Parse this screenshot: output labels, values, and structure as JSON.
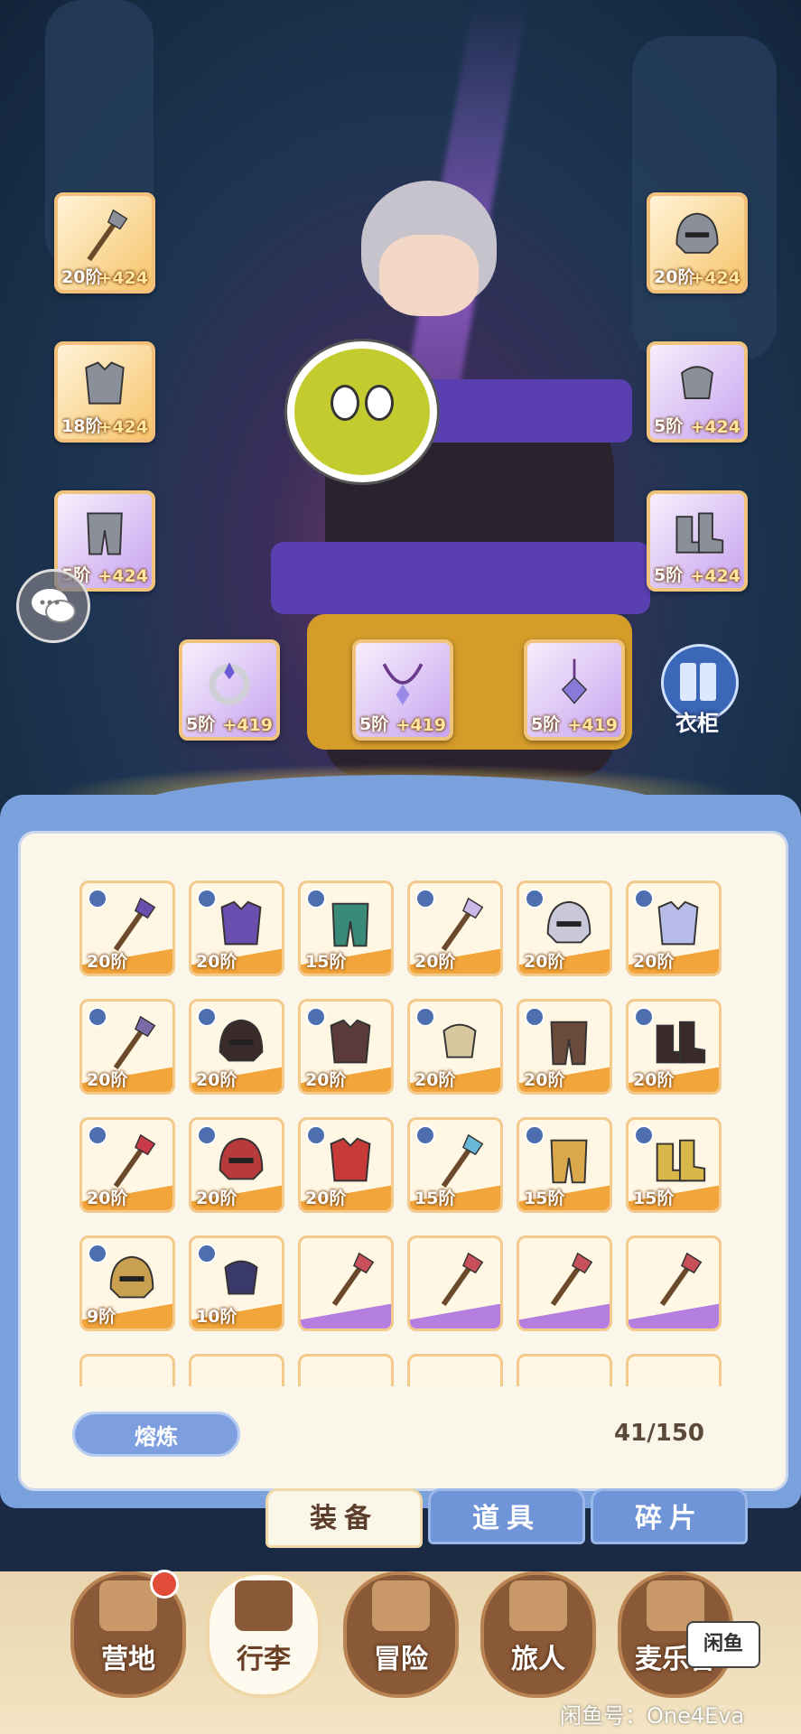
{
  "equipped": [
    {
      "name": "slot-weapon",
      "tier": "20阶",
      "bonus": "+424",
      "color": "#f6c46a",
      "icon": "weapon-staff-icon"
    },
    {
      "name": "slot-helmet",
      "tier": "20阶",
      "bonus": "+424",
      "color": "#f6c46a",
      "icon": "helmet-icon"
    },
    {
      "name": "slot-armor",
      "tier": "18阶",
      "bonus": "+424",
      "color": "#f6c46a",
      "icon": "armor-icon"
    },
    {
      "name": "slot-gloves",
      "tier": "5阶",
      "bonus": "+424",
      "color": "#c7a4ef",
      "icon": "gloves-icon"
    },
    {
      "name": "slot-pants",
      "tier": "5阶",
      "bonus": "+424",
      "color": "#c7a4ef",
      "icon": "pants-icon"
    },
    {
      "name": "slot-boots",
      "tier": "5阶",
      "bonus": "+424",
      "color": "#c7a4ef",
      "icon": "boots-icon"
    },
    {
      "name": "slot-ring",
      "tier": "5阶",
      "bonus": "+419",
      "color": "#c7a4ef",
      "icon": "ring-icon"
    },
    {
      "name": "slot-necklace",
      "tier": "5阶",
      "bonus": "+419",
      "color": "#c7a4ef",
      "icon": "necklace-icon"
    },
    {
      "name": "slot-charm",
      "tier": "5阶",
      "bonus": "+419",
      "color": "#c7a4ef",
      "icon": "charm-icon"
    }
  ],
  "wardrobe": {
    "label": "衣柜"
  },
  "inventory": {
    "items": [
      {
        "tier": "20阶",
        "rarity": "orange",
        "icon": "staff-icon",
        "tint": "#6a4fb0"
      },
      {
        "tier": "20阶",
        "rarity": "orange",
        "icon": "armor-icon",
        "tint": "#6a4fb0"
      },
      {
        "tier": "15阶",
        "rarity": "orange",
        "icon": "pants-icon",
        "tint": "#3a8a7a"
      },
      {
        "tier": "20阶",
        "rarity": "orange",
        "icon": "staff-icon",
        "tint": "#c9b8e8"
      },
      {
        "tier": "20阶",
        "rarity": "orange",
        "icon": "helmet-icon",
        "tint": "#c8c8d8"
      },
      {
        "tier": "20阶",
        "rarity": "orange",
        "icon": "armor-icon",
        "tint": "#b8bce8"
      },
      {
        "tier": "20阶",
        "rarity": "orange",
        "icon": "staff-icon",
        "tint": "#7a6aa8"
      },
      {
        "tier": "20阶",
        "rarity": "orange",
        "icon": "helmet-icon",
        "tint": "#3a2a2a"
      },
      {
        "tier": "20阶",
        "rarity": "orange",
        "icon": "armor-icon",
        "tint": "#5a3a3a"
      },
      {
        "tier": "20阶",
        "rarity": "orange",
        "icon": "gloves-icon",
        "tint": "#d8c8a0"
      },
      {
        "tier": "20阶",
        "rarity": "orange",
        "icon": "pants-icon",
        "tint": "#6a4a3a"
      },
      {
        "tier": "20阶",
        "rarity": "orange",
        "icon": "boots-icon",
        "tint": "#3a2a2a"
      },
      {
        "tier": "20阶",
        "rarity": "orange",
        "icon": "staff-icon",
        "tint": "#c83a4a"
      },
      {
        "tier": "20阶",
        "rarity": "orange",
        "icon": "helmet-icon",
        "tint": "#b83a3a"
      },
      {
        "tier": "20阶",
        "rarity": "orange",
        "icon": "armor-icon",
        "tint": "#c83a3a"
      },
      {
        "tier": "15阶",
        "rarity": "orange",
        "icon": "staff-icon",
        "tint": "#6ab8d8"
      },
      {
        "tier": "15阶",
        "rarity": "orange",
        "icon": "pants-icon",
        "tint": "#d8a84a"
      },
      {
        "tier": "15阶",
        "rarity": "orange",
        "icon": "boots-icon",
        "tint": "#d8b84a"
      },
      {
        "tier": "9阶",
        "rarity": "orange",
        "icon": "helmet-icon",
        "tint": "#c8a050"
      },
      {
        "tier": "10阶",
        "rarity": "orange",
        "icon": "gloves-icon",
        "tint": "#3a3a6a"
      },
      {
        "tier": "",
        "rarity": "purple",
        "icon": "staff-icon",
        "tint": "#c8505a"
      },
      {
        "tier": "",
        "rarity": "purple",
        "icon": "staff-icon",
        "tint": "#c8505a"
      },
      {
        "tier": "",
        "rarity": "purple",
        "icon": "staff-icon",
        "tint": "#c8505a"
      },
      {
        "tier": "",
        "rarity": "purple",
        "icon": "staff-icon",
        "tint": "#c8505a"
      },
      {
        "tier": "",
        "rarity": "orange",
        "icon": "item-icon",
        "tint": "#d8b84a"
      },
      {
        "tier": "",
        "rarity": "orange",
        "icon": "item-icon",
        "tint": "#c83a3a"
      },
      {
        "tier": "",
        "rarity": "orange",
        "icon": "item-icon",
        "tint": "#c8b8a0"
      },
      {
        "tier": "",
        "rarity": "orange",
        "icon": "item-icon",
        "tint": "#b82a2a"
      },
      {
        "tier": "",
        "rarity": "orange",
        "icon": "item-icon",
        "tint": "#b82a2a"
      },
      {
        "tier": "",
        "rarity": "orange",
        "icon": "item-icon",
        "tint": "#d8a0a0"
      }
    ],
    "smelt_label": "熔炼",
    "count": "41/150"
  },
  "tabs": [
    {
      "label": "装备",
      "active": true
    },
    {
      "label": "道具",
      "active": false
    },
    {
      "label": "碎片",
      "active": false
    }
  ],
  "nav": [
    {
      "label": "营地",
      "icon": "castle-icon",
      "active": false
    },
    {
      "label": "行李",
      "icon": "backpack-icon",
      "active": true
    },
    {
      "label": "冒险",
      "icon": "crossed-swords-icon",
      "active": false
    },
    {
      "label": "旅人",
      "icon": "traveler-icon",
      "active": false
    },
    {
      "label": "麦乐鲁",
      "icon": "cat-icon",
      "active": false
    }
  ],
  "watermark": {
    "logo": "闲鱼",
    "text": "闲鱼号：One4Eva"
  },
  "colors": {
    "panel_frame": "#7aa1dc",
    "panel_bg": "#fbf6ea",
    "orange_rarity": "#f2a53a",
    "purple_rarity": "#b57fe0"
  }
}
